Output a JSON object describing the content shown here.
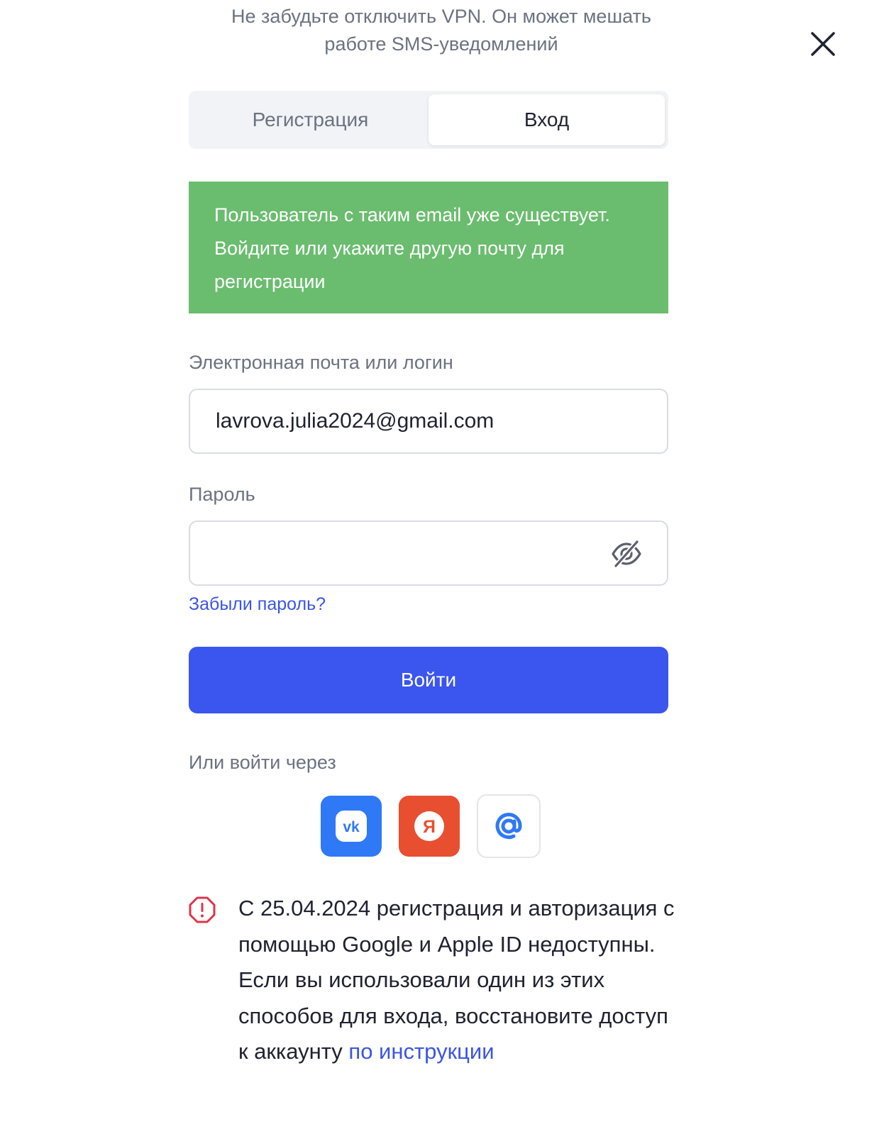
{
  "notice": {
    "vpn_line1": "Не забудьте отключить VPN. Он может мешать",
    "vpn_line2": "работе SMS-уведомлений"
  },
  "tabs": [
    {
      "label": "Регистрация",
      "active": false
    },
    {
      "label": "Вход",
      "active": true
    }
  ],
  "alert": {
    "text": "Пользователь с таким email уже существует. Войдите или укажите другую почту для регистрации",
    "background": "#6abd6e"
  },
  "form": {
    "email_label": "Электронная почта или логин",
    "email_value": "lavrova.julia2024@gmail.com",
    "password_label": "Пароль",
    "password_value": "",
    "forgot_link": "Забыли пароль?",
    "submit_label": "Войти"
  },
  "alt_login": {
    "label": "Или войти через",
    "providers": [
      {
        "icon": "vk-icon",
        "color": "#2f79f6"
      },
      {
        "icon": "yandex-icon",
        "color": "#e84f30"
      },
      {
        "icon": "mail-ru-icon",
        "color": "#2f79f6"
      }
    ]
  },
  "warning": {
    "text": "С 25.04.2024 регистрация и авторизация с помощью Google и Apple ID недоступны. Если вы использовали один из этих способов для входа, восстановите доступ к аккаунту ",
    "link": "по инструкции"
  },
  "colors": {
    "accent": "#3b55ef",
    "link": "#3b55e6",
    "warning": "#e0334a"
  }
}
